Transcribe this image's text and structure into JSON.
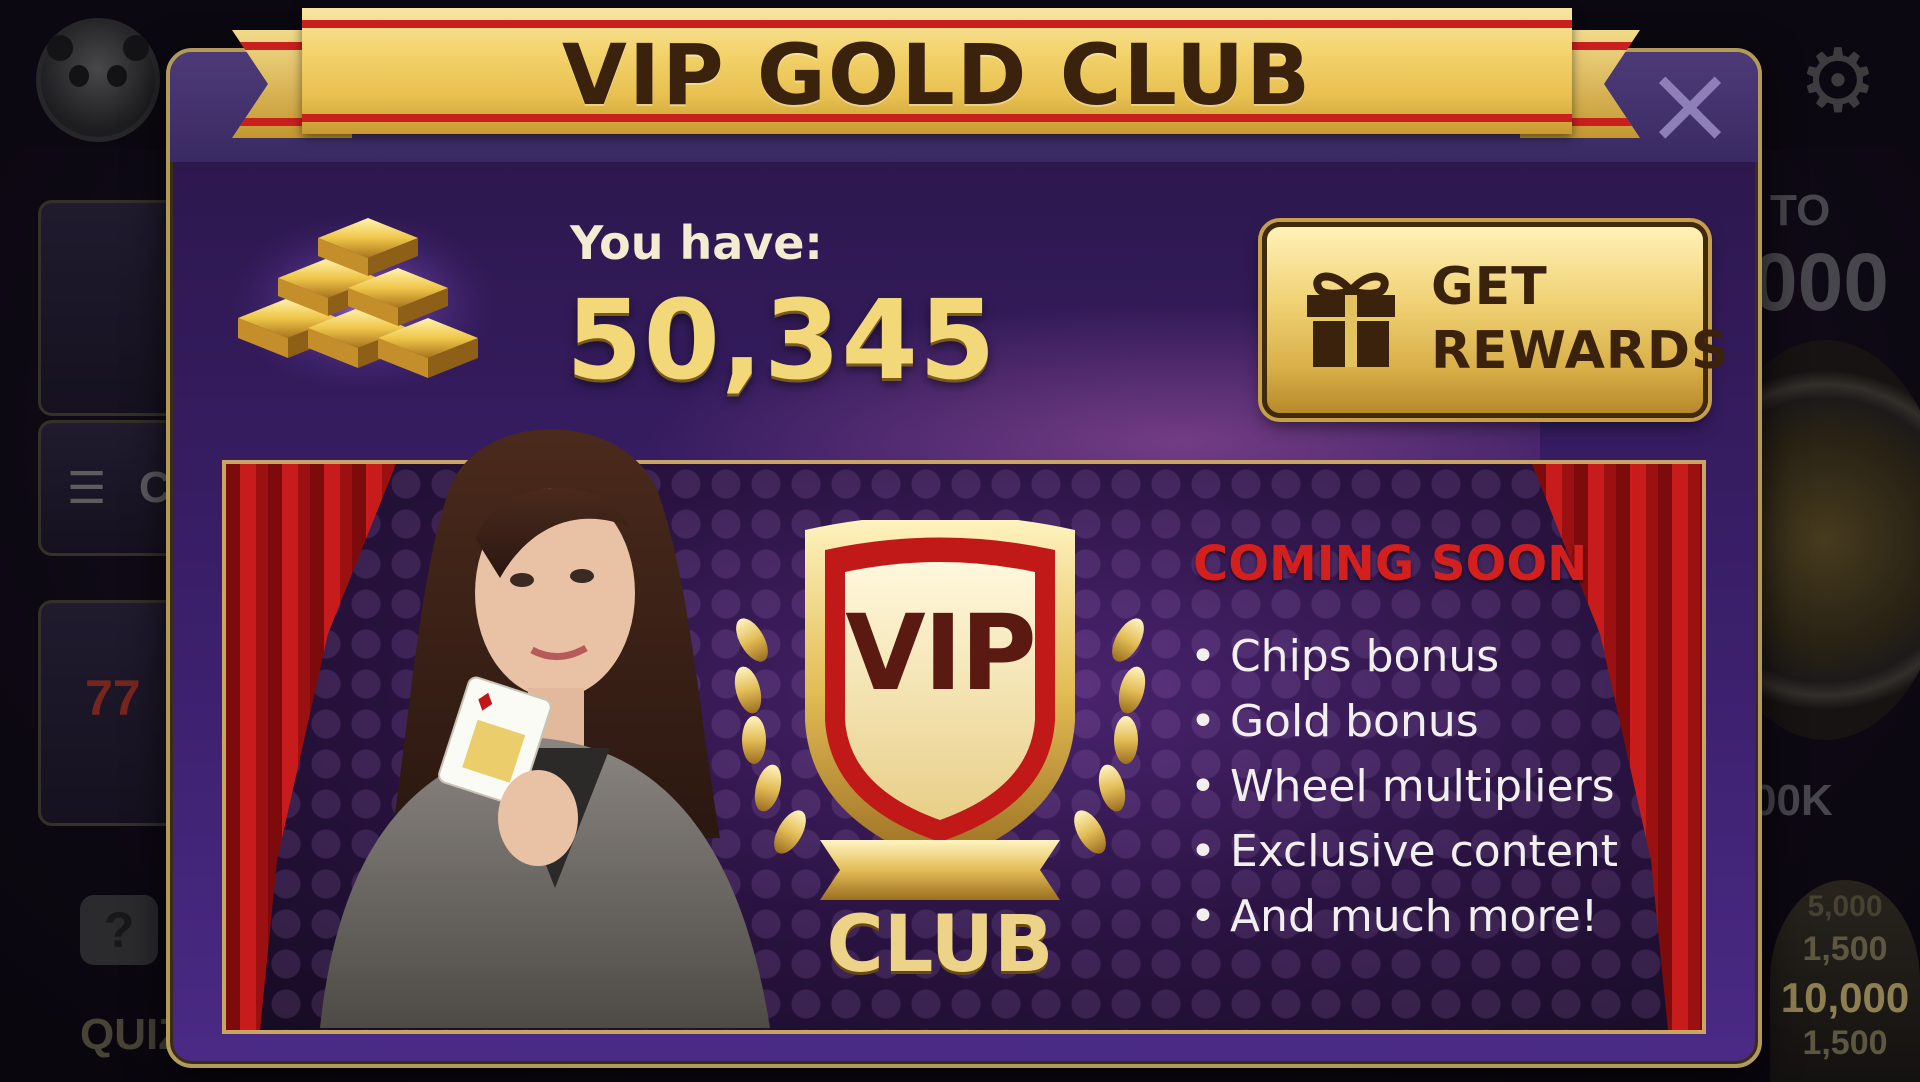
{
  "background": {
    "quiz_label": "QUIZ",
    "right_label_top": "TO",
    "right_value_top": "000",
    "right_label_mid": "00K",
    "stack_values": [
      "5,000",
      "1,500",
      "10,000",
      "1,500"
    ],
    "side_card_label": "C"
  },
  "modal": {
    "title": "VIP GOLD CLUB",
    "close_glyph": "×",
    "gold": {
      "label": "You have:",
      "amount": "50,345"
    },
    "rewards_button": {
      "line1": "GET",
      "line2": "REWARDS"
    },
    "emblem": {
      "shield_text": "VIP",
      "club_text": "CLUB"
    },
    "coming_soon": {
      "heading": "COMING SOON",
      "items": [
        "Chips bonus",
        "Gold bonus",
        "Wheel multipliers",
        "Exclusive content",
        "And much more!"
      ]
    }
  },
  "icons": {
    "gold": "gold-bars-icon",
    "gift": "gift-icon",
    "close": "close-icon",
    "settings": "gear-icon"
  },
  "colors": {
    "banner_gold": "#f3d36c",
    "title_brown": "#3a220c",
    "amount_gold": "#f3d879",
    "coming_soon_red": "#d41f1f",
    "modal_purple": "#3a1f6a"
  }
}
